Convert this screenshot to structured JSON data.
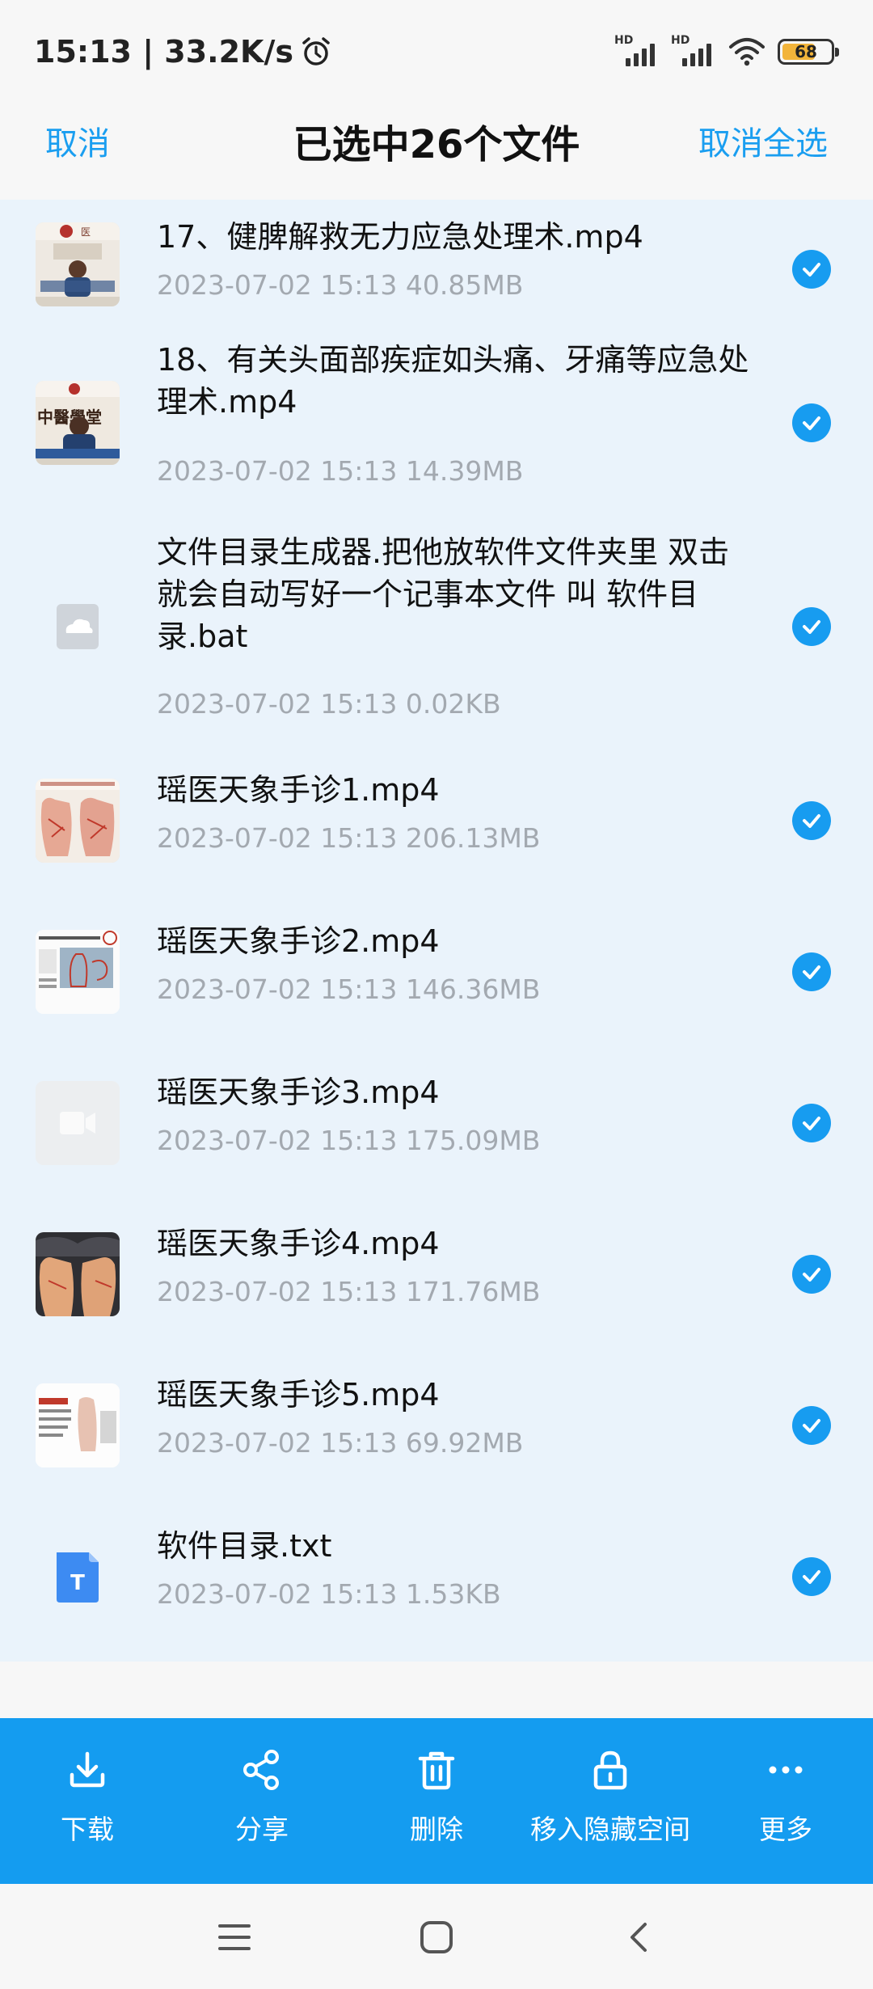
{
  "status_bar": {
    "time_speed": "15:13 | 33.2K/s",
    "signal1_label": "HD",
    "signal2_label": "HD",
    "battery": "68"
  },
  "header": {
    "cancel": "取消",
    "title": "已选中26个文件",
    "cancel_all": "取消全选"
  },
  "files": [
    {
      "name": "17、健脾解救无力应急处理术.mp4",
      "meta": "2023-07-02  15:13  40.85MB",
      "thumb": "video-thumb-lecture"
    },
    {
      "name": "18、有关头面部疾症如头痛、牙痛等应急处理术.mp4",
      "meta": "2023-07-02  15:13  14.39MB",
      "thumb": "video-thumb-lecture"
    },
    {
      "name": "文件目录生成器.把他放软件文件夹里 双击 就会自动写好一个记事本文件 叫 软件目录.bat",
      "meta": "2023-07-02  15:13  0.02KB",
      "thumb": "cloud-file-icon"
    },
    {
      "name": "瑶医天象手诊1.mp4",
      "meta": "2023-07-02  15:13  206.13MB",
      "thumb": "video-thumb-palms"
    },
    {
      "name": "瑶医天象手诊2.mp4",
      "meta": "2023-07-02  15:13  146.36MB",
      "thumb": "video-thumb-diagram"
    },
    {
      "name": "瑶医天象手诊3.mp4",
      "meta": "2023-07-02  15:13  175.09MB",
      "thumb": "video-placeholder-icon"
    },
    {
      "name": "瑶医天象手诊4.mp4",
      "meta": "2023-07-02  15:13  171.76MB",
      "thumb": "video-thumb-hands"
    },
    {
      "name": "瑶医天象手诊5.mp4",
      "meta": "2023-07-02  15:13  69.92MB",
      "thumb": "video-thumb-slide"
    },
    {
      "name": "软件目录.txt",
      "meta": "2023-07-02  15:13  1.53KB",
      "thumb": "text-file-icon"
    }
  ],
  "thumb_texts": {
    "lecture_logo": "医",
    "banner1": "中醫學堂",
    "doc_letter": "T"
  },
  "actions": [
    {
      "label": "下载",
      "icon": "download-icon"
    },
    {
      "label": "分享",
      "icon": "share-icon"
    },
    {
      "label": "删除",
      "icon": "trash-icon"
    },
    {
      "label": "移入隐藏空间",
      "icon": "lock-icon"
    },
    {
      "label": "更多",
      "icon": "more-icon"
    }
  ],
  "colors": {
    "accent": "#179cf0",
    "list_bg": "#eaf3fb",
    "meta_text": "#a3a9b0"
  }
}
